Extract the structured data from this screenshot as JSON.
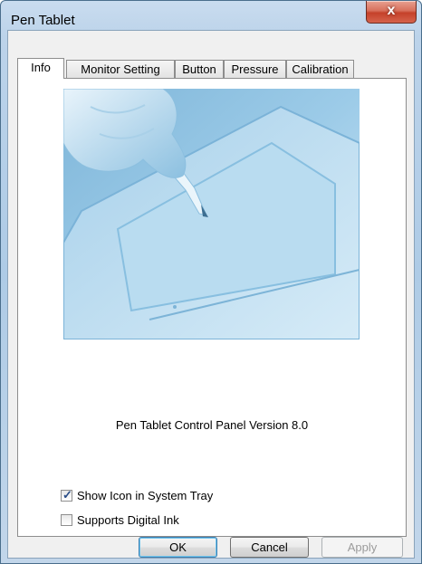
{
  "window": {
    "title": "Pen Tablet",
    "close_label": "x"
  },
  "tabs": [
    {
      "label": "Info",
      "active": true
    },
    {
      "label": "Monitor Setting",
      "active": false
    },
    {
      "label": "Button",
      "active": false
    },
    {
      "label": "Pressure",
      "active": false
    },
    {
      "label": "Calibration",
      "active": false
    }
  ],
  "info": {
    "version_text": "Pen Tablet Control Panel Version 8.0",
    "show_icon": {
      "label": "Show Icon in System Tray",
      "checked": true
    },
    "digital_ink": {
      "label": "Supports Digital Ink",
      "checked": false
    }
  },
  "buttons": {
    "ok": "OK",
    "cancel": "Cancel",
    "apply": "Apply"
  },
  "colors": {
    "accent": "#3c7fb1",
    "close": "#c5412a",
    "illustration": "#8fc4e4"
  }
}
